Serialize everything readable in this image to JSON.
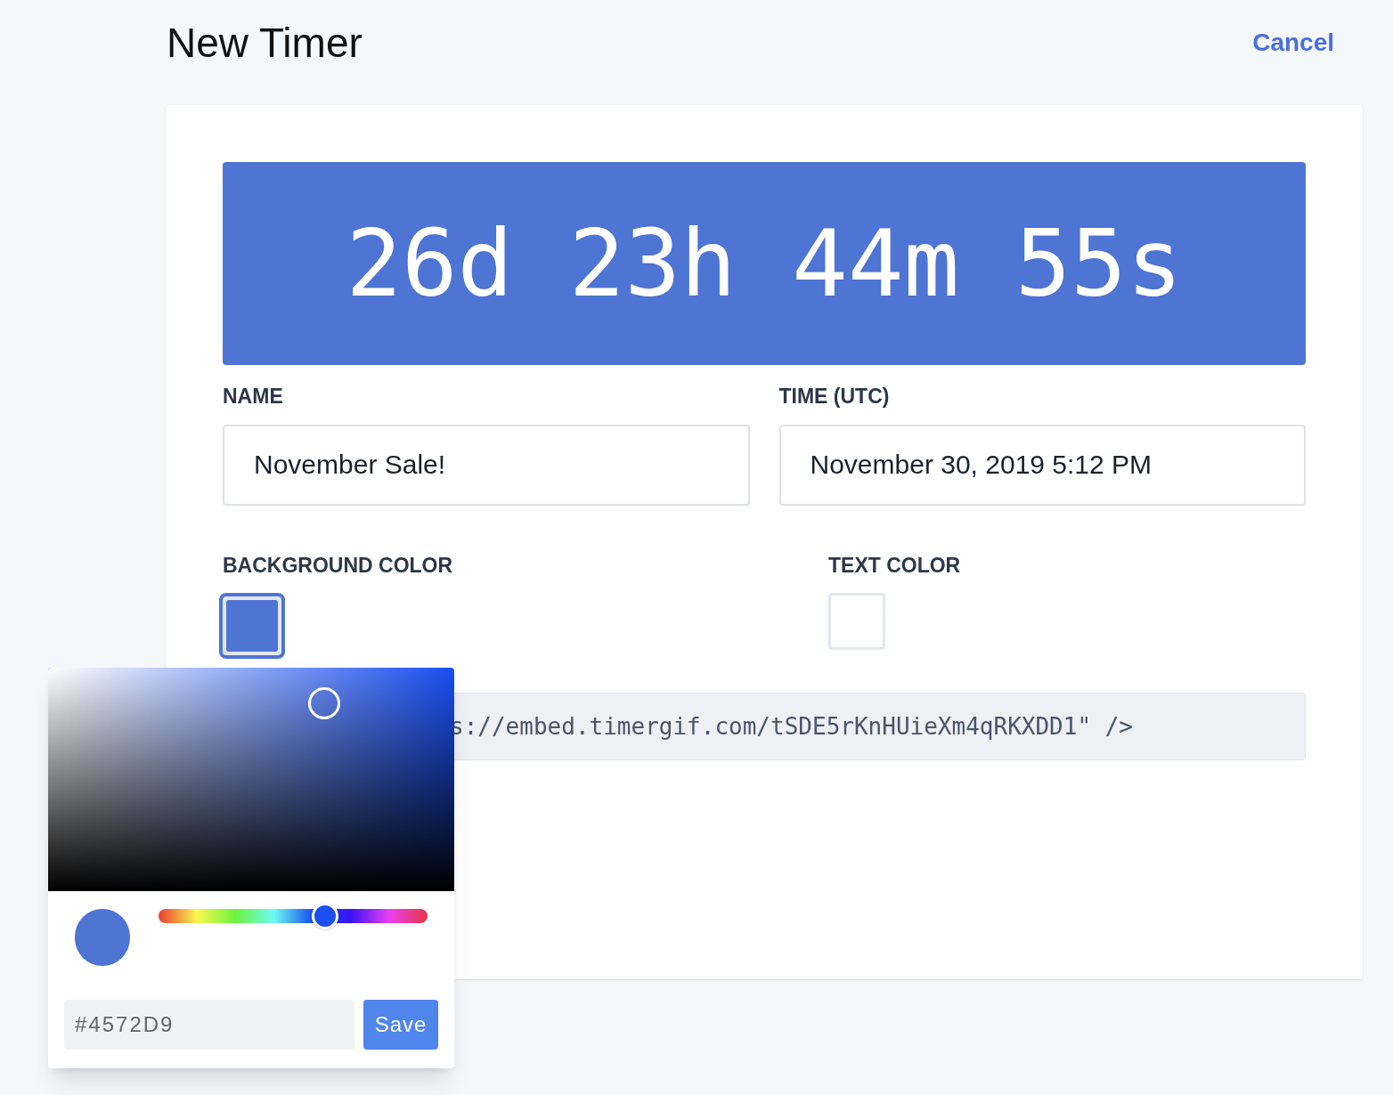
{
  "header": {
    "title": "New Timer",
    "cancel": "Cancel"
  },
  "preview": {
    "text": "26d 23h 44m 55s"
  },
  "fields": [
    {
      "label": "NAME",
      "value": "November Sale!"
    },
    {
      "label": "TIME (UTC)",
      "value": "November 30, 2019 5:12 PM"
    }
  ],
  "colors": [
    {
      "label": "BACKGROUND COLOR",
      "color": "#4e74d4",
      "selected": true
    },
    {
      "label": "TEXT COLOR",
      "color": "#ffffff",
      "selected": false
    }
  ],
  "embed_code": "s://embed.timergif.com/tSDE5rKnHUieXm4qRKXDD1\" />",
  "color_picker": {
    "hue": {
      "level": 0.62
    },
    "hex_value": "#4572D9",
    "save": "Save"
  }
}
